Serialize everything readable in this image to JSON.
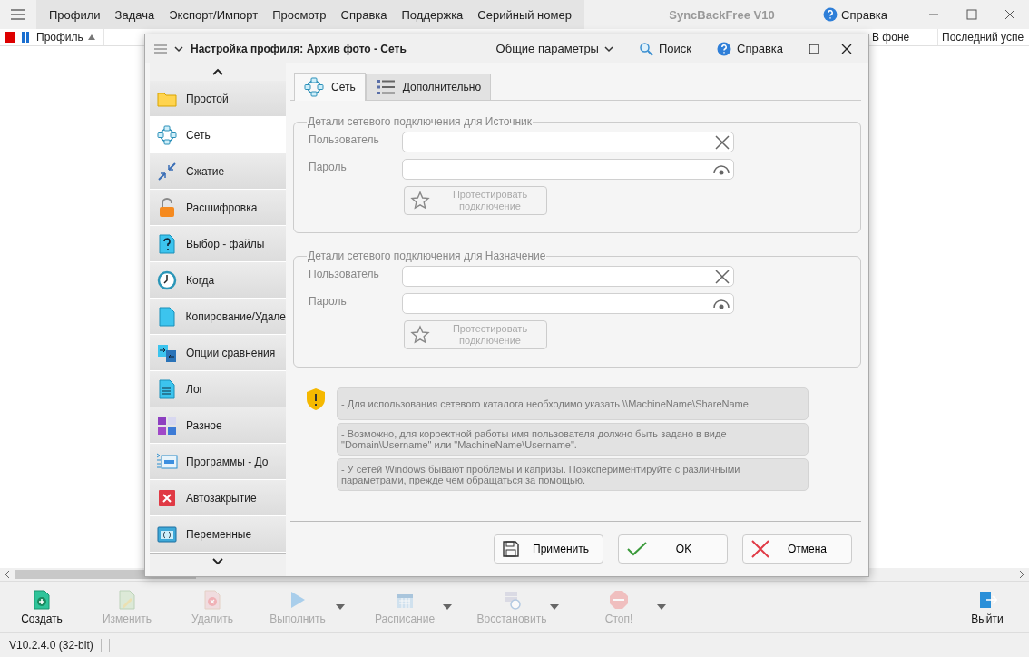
{
  "main_menu": {
    "items": [
      "Профили",
      "Задача",
      "Экспорт/Импорт",
      "Просмотр",
      "Справка",
      "Поддержка",
      "Серийный номер"
    ]
  },
  "app_title": "SyncBackFree V10",
  "help_link": "Справка",
  "list_header": {
    "columns": [
      {
        "label": "Профиль",
        "sorted": true
      },
      {
        "label": "В фоне"
      },
      {
        "label": "Последний успе"
      }
    ]
  },
  "dialog": {
    "title": "Настройка профиля: Архив фото - Сеть",
    "header_links": [
      {
        "label": "Общие параметры",
        "kind": "dropdown"
      },
      {
        "label": "Поиск",
        "kind": "search"
      },
      {
        "label": "Справка",
        "kind": "help"
      }
    ],
    "nav": {
      "items": [
        {
          "label": "Простой",
          "kind": "folder",
          "selected": false
        },
        {
          "label": "Сеть",
          "kind": "network",
          "selected": true
        },
        {
          "label": "Сжатие",
          "kind": "compress",
          "selected": false
        },
        {
          "label": "Расшифровка",
          "kind": "lock",
          "selected": false
        },
        {
          "label": "Выбор - файлы",
          "kind": "question",
          "selected": false
        },
        {
          "label": "Когда",
          "kind": "clock",
          "selected": false
        },
        {
          "label": "Копирование/Удале",
          "kind": "page",
          "selected": false
        },
        {
          "label": "Опции сравнения",
          "kind": "compare",
          "selected": false
        },
        {
          "label": "Лог",
          "kind": "log",
          "selected": false
        },
        {
          "label": "Разное",
          "kind": "tiles",
          "selected": false
        },
        {
          "label": "Программы - До",
          "kind": "programs",
          "selected": false
        },
        {
          "label": "Автозакрытие",
          "kind": "xbox",
          "selected": false
        },
        {
          "label": "Переменные",
          "kind": "vars",
          "selected": false
        }
      ]
    },
    "tabs": [
      {
        "label": "Сеть",
        "kind": "network",
        "selected": true
      },
      {
        "label": "Дополнительно",
        "kind": "list",
        "selected": false
      }
    ],
    "groups": [
      {
        "title": "Детали сетевого подключения для Источник",
        "fields": [
          {
            "label": "Пользователь",
            "kind": "clear"
          },
          {
            "label": "Пароль",
            "kind": "reveal"
          }
        ],
        "test_button": {
          "label": "Протестировать подключение",
          "disabled": true
        }
      },
      {
        "title": "Детали сетевого подключения для Назначение",
        "fields": [
          {
            "label": "Пользователь",
            "kind": "clear"
          },
          {
            "label": "Пароль",
            "kind": "reveal"
          }
        ],
        "test_button": {
          "label": "Протестировать подключение",
          "disabled": true
        }
      }
    ],
    "notes": [
      "- Для использования сетевого каталога необходимо указать \\\\MachineName\\ShareName",
      "- Возможно, для корректной работы имя пользователя должно быть задано в виде \"Domain\\Username\" или \"MachineName\\Username\".",
      "- У сетей Windows бывают проблемы и капризы. Поэкспериментируйте с различными параметрами, прежде чем обращаться за помощью."
    ],
    "buttons": [
      {
        "label": "Применить",
        "kind": "save"
      },
      {
        "label": "OK",
        "kind": "ok"
      },
      {
        "label": "Отмена",
        "kind": "cancel"
      }
    ]
  },
  "toolbar": [
    {
      "label": "Создать",
      "kind": "new",
      "disabled": false,
      "dropdown": false
    },
    {
      "label": "Изменить",
      "kind": "edit",
      "disabled": true,
      "dropdown": false
    },
    {
      "label": "Удалить",
      "kind": "delete",
      "disabled": true,
      "dropdown": false
    },
    {
      "label": "Выполнить",
      "kind": "run",
      "disabled": true,
      "dropdown": true
    },
    {
      "label": "Расписание",
      "kind": "schedule",
      "disabled": true,
      "dropdown": true
    },
    {
      "label": "Восстановить",
      "kind": "restore",
      "disabled": true,
      "dropdown": true
    },
    {
      "label": "Стоп!",
      "kind": "stop",
      "disabled": true,
      "dropdown": true
    }
  ],
  "exit_button": {
    "label": "Выйти",
    "disabled": false
  },
  "status_bar": {
    "version": "V10.2.4.0 (32-bit)"
  }
}
